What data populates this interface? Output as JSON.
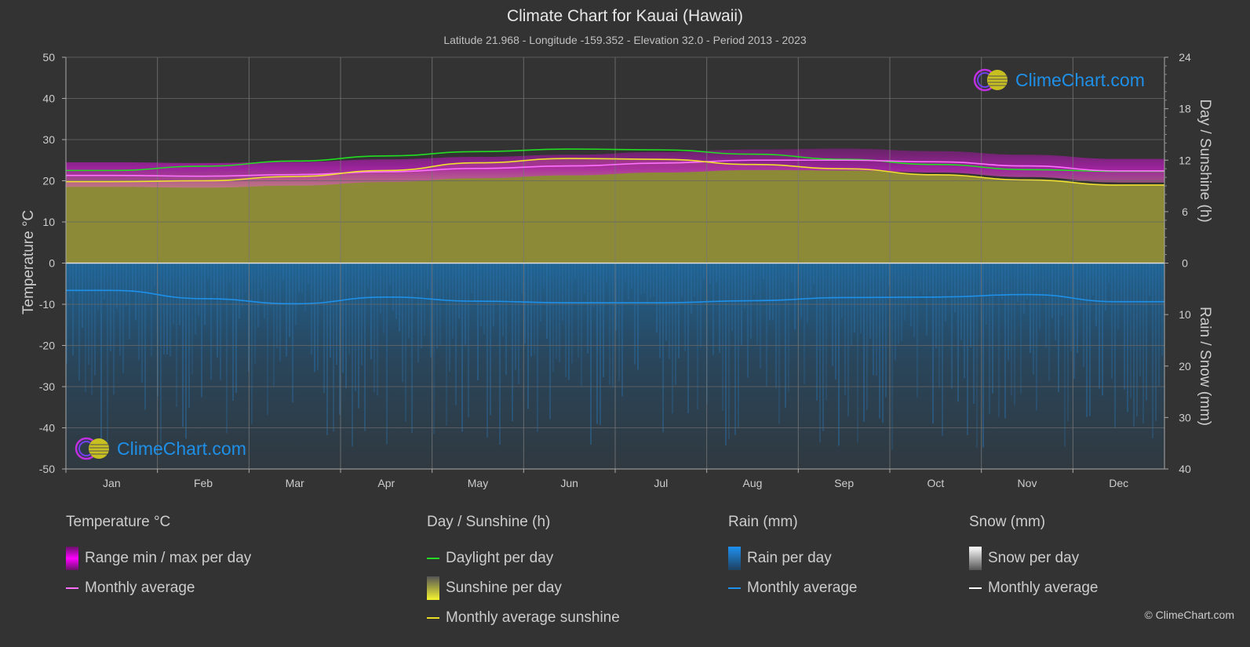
{
  "header": {
    "title": "Climate Chart for Kauai (Hawaii)",
    "subtitle": "Latitude 21.968 - Longitude -159.352 - Elevation 32.0 - Period 2013 - 2023"
  },
  "axes": {
    "left_title": "Temperature °C",
    "right_top_title": "Day / Sunshine (h)",
    "right_bottom_title": "Rain / Snow (mm)"
  },
  "logo": {
    "text": "ClimeChart.com"
  },
  "legend": {
    "temperature": {
      "title": "Temperature °C",
      "range_label": "Range min / max per day",
      "avg_label": "Monthly average"
    },
    "sunshine": {
      "title": "Day / Sunshine (h)",
      "daylight_label": "Daylight per day",
      "sunshine_label": "Sunshine per day",
      "avg_label": "Monthly average sunshine"
    },
    "rain": {
      "title": "Rain (mm)",
      "per_day_label": "Rain per day",
      "avg_label": "Monthly average"
    },
    "snow": {
      "title": "Snow (mm)",
      "per_day_label": "Snow per day",
      "avg_label": "Monthly average"
    }
  },
  "copyright": "© ClimeChart.com",
  "colors": {
    "temp_avg": "#ff70ff",
    "temp_range": "#b020b0",
    "daylight": "#22dd22",
    "sunshine_fill": "#8c8a36",
    "sunshine_avg": "#f0e030",
    "rain_fill": "#1e5a88",
    "rain_avg": "#1e90e8",
    "grid": "#5a5a5a"
  },
  "chart_data": {
    "type": "line",
    "title": "Climate Chart for Kauai (Hawaii)",
    "categories": [
      "Jan",
      "Feb",
      "Mar",
      "Apr",
      "May",
      "Jun",
      "Jul",
      "Aug",
      "Sep",
      "Oct",
      "Nov",
      "Dec"
    ],
    "left_axis": {
      "label": "Temperature °C",
      "range": [
        -50,
        50
      ],
      "ticks": [
        50,
        40,
        30,
        20,
        10,
        0,
        -10,
        -20,
        -30,
        -40,
        -50
      ]
    },
    "right_axis_top": {
      "label": "Day / Sunshine (h)",
      "range": [
        0,
        24
      ],
      "ticks": [
        24,
        18,
        12,
        6,
        0
      ]
    },
    "right_axis_bottom": {
      "label": "Rain / Snow (mm)",
      "range": [
        0,
        40
      ],
      "ticks": [
        0,
        10,
        20,
        30,
        40
      ]
    },
    "grid": true,
    "legend_position": "bottom",
    "series": [
      {
        "name": "Temperature monthly average (°C)",
        "axis": "left",
        "values": [
          21.3,
          21.1,
          21.5,
          22.2,
          23.0,
          23.6,
          24.3,
          25.0,
          25.0,
          24.6,
          23.6,
          22.4
        ]
      },
      {
        "name": "Temperature daily max approx (°C)",
        "axis": "left",
        "values": [
          24.5,
          24.3,
          24.6,
          25.2,
          25.8,
          26.3,
          27.0,
          27.6,
          27.8,
          27.2,
          26.3,
          25.3
        ]
      },
      {
        "name": "Temperature daily min approx (°C)",
        "axis": "left",
        "values": [
          18.5,
          18.3,
          18.8,
          19.7,
          20.6,
          21.3,
          22.0,
          22.6,
          22.5,
          22.0,
          20.9,
          19.6
        ]
      },
      {
        "name": "Daylight per day (h)",
        "axis": "right_top",
        "values": [
          10.8,
          11.3,
          11.9,
          12.5,
          13.0,
          13.3,
          13.2,
          12.7,
          12.1,
          11.5,
          10.9,
          10.7
        ]
      },
      {
        "name": "Monthly average sunshine (h)",
        "axis": "right_top",
        "values": [
          9.5,
          9.6,
          10.1,
          10.8,
          11.7,
          12.2,
          12.1,
          11.5,
          11.0,
          10.3,
          9.7,
          9.1
        ]
      },
      {
        "name": "Rain monthly average (mm)",
        "axis": "right_bottom",
        "values": [
          5.3,
          6.9,
          7.9,
          6.6,
          7.4,
          7.7,
          7.7,
          7.3,
          6.7,
          6.6,
          6.1,
          7.5
        ]
      }
    ]
  }
}
